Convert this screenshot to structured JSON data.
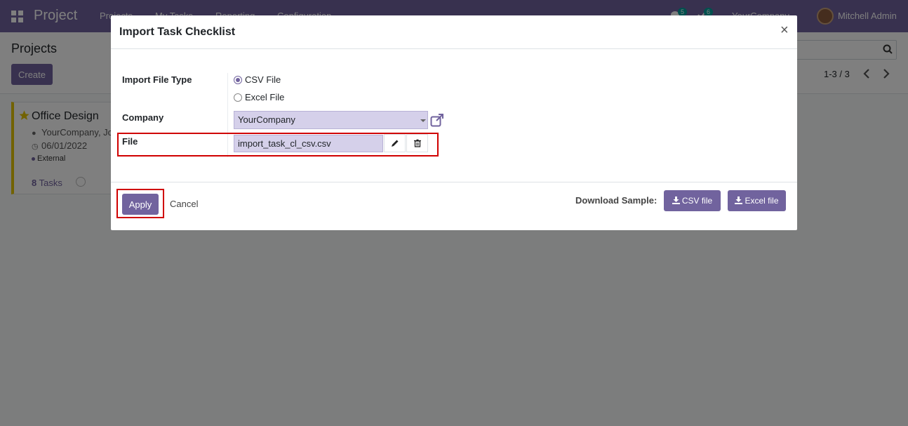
{
  "navbar": {
    "brand": "Project",
    "menu": [
      "Projects",
      "My Tasks",
      "Reporting",
      "Configuration"
    ],
    "messages_count": "5",
    "activities_count": "6",
    "company": "YourCompany",
    "user": "Mitchell Admin"
  },
  "control_panel": {
    "title": "Projects",
    "create_label": "Create",
    "pager": "1-3 / 3"
  },
  "kanban": {
    "card": {
      "title": "Office Design",
      "partner": "YourCompany, Jo",
      "date": "06/01/2022",
      "tag": "External",
      "task_count": "8",
      "task_label": "Tasks"
    }
  },
  "modal": {
    "title": "Import Task Checklist",
    "fields": {
      "import_file_type_label": "Import File Type",
      "option_csv": "CSV File",
      "option_excel": "Excel File",
      "selected_option": "CSV File",
      "company_label": "Company",
      "company_value": "YourCompany",
      "file_label": "File",
      "file_value": "import_task_cl_csv.csv"
    },
    "footer": {
      "apply_label": "Apply",
      "cancel_label": "Cancel",
      "download_label": "Download Sample:",
      "csv_sample_label": "CSV file",
      "excel_sample_label": "Excel file"
    }
  },
  "colors": {
    "brand": "#71639e",
    "highlight": "#d00000",
    "field_bg": "#d5d0ea"
  }
}
